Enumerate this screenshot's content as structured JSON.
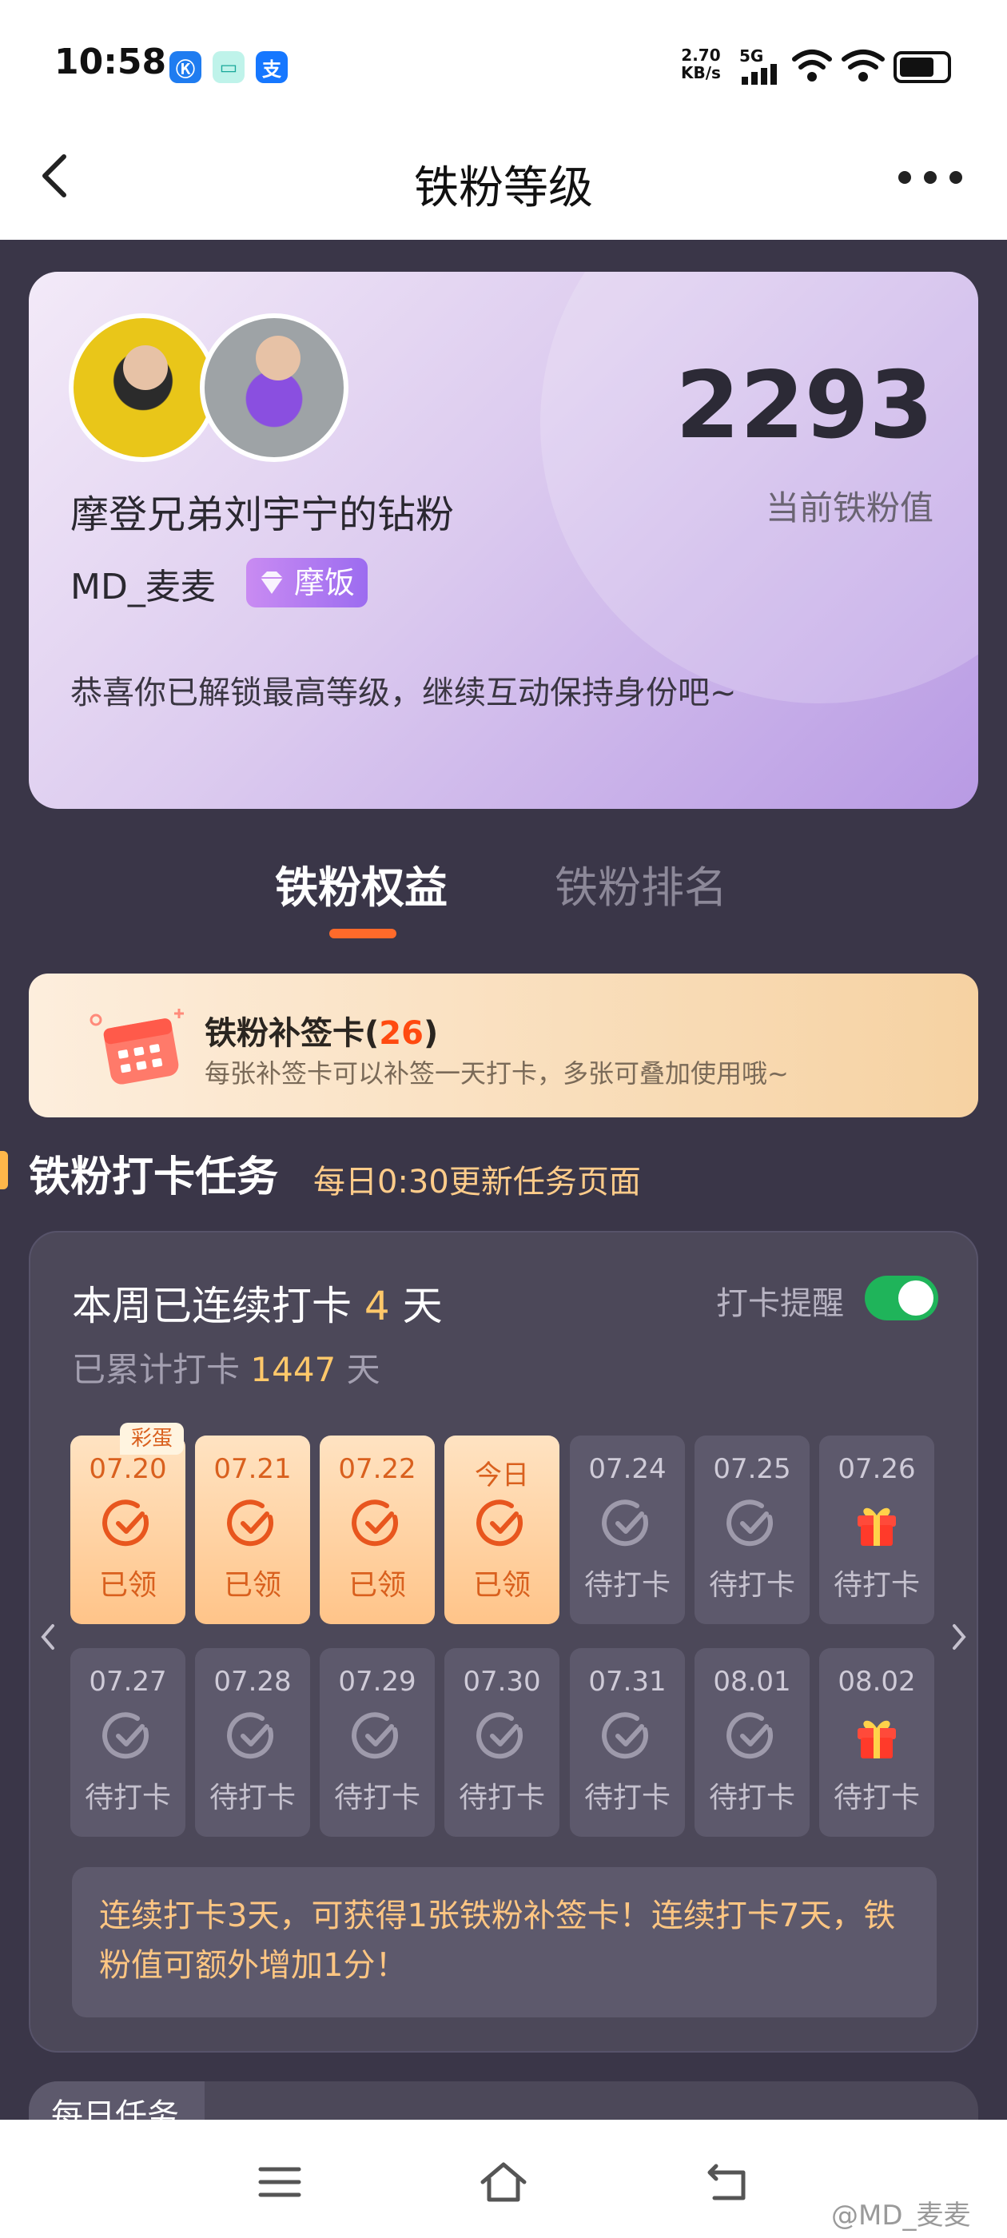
{
  "status_bar": {
    "time": "10:58",
    "network_speed": "2.70",
    "network_unit": "KB/s",
    "cellular": "5G",
    "battery_level": 0.75
  },
  "header": {
    "title": "铁粉等级"
  },
  "profile": {
    "fan_value": "2293",
    "fan_value_label": "当前铁粉值",
    "fan_title": "摩登兄弟刘宇宁的钻粉",
    "username": "MD_麦麦",
    "badge": "摩饭",
    "congrats": "恭喜你已解锁最高等级，继续互动保持身份吧~"
  },
  "tabs": [
    {
      "label": "铁粉权益",
      "active": true
    },
    {
      "label": "铁粉排名",
      "active": false
    }
  ],
  "resign_card": {
    "title": "铁粉补签卡",
    "count_open": "(",
    "count": "26",
    "count_close": ")",
    "desc": "每张补签卡可以补签一天打卡，多张可叠加使用哦~"
  },
  "section": {
    "title": "铁粉打卡任务",
    "subtitle": "每日0:30更新任务页面"
  },
  "checkin": {
    "streak_prefix": "本周已连续打卡",
    "streak_days": "4",
    "streak_suffix": "天",
    "total_prefix": "已累计打卡",
    "total_days": "1447",
    "total_suffix": "天",
    "reminder_label": "打卡提醒",
    "reminder_on": true,
    "egg_tag": "彩蛋",
    "days": [
      {
        "date": "07.20",
        "status": "已领",
        "done": true,
        "gift": false
      },
      {
        "date": "07.21",
        "status": "已领",
        "done": true,
        "gift": false
      },
      {
        "date": "07.22",
        "status": "已领",
        "done": true,
        "gift": false
      },
      {
        "date": "今日",
        "status": "已领",
        "done": true,
        "gift": false
      },
      {
        "date": "07.24",
        "status": "待打卡",
        "done": false,
        "gift": false
      },
      {
        "date": "07.25",
        "status": "待打卡",
        "done": false,
        "gift": false
      },
      {
        "date": "07.26",
        "status": "待打卡",
        "done": false,
        "gift": true
      },
      {
        "date": "07.27",
        "status": "待打卡",
        "done": false,
        "gift": false
      },
      {
        "date": "07.28",
        "status": "待打卡",
        "done": false,
        "gift": false
      },
      {
        "date": "07.29",
        "status": "待打卡",
        "done": false,
        "gift": false
      },
      {
        "date": "07.30",
        "status": "待打卡",
        "done": false,
        "gift": false
      },
      {
        "date": "07.31",
        "status": "待打卡",
        "done": false,
        "gift": false
      },
      {
        "date": "08.01",
        "status": "待打卡",
        "done": false,
        "gift": false
      },
      {
        "date": "08.02",
        "status": "待打卡",
        "done": false,
        "gift": true
      }
    ],
    "tip": "连续打卡3天，可获得1张铁粉补签卡！连续打卡7天，铁粉值可额外增加1分！"
  },
  "daily_tasks": {
    "label": "每日任务"
  },
  "watermark": "@MD_麦麦",
  "colors": {
    "accent": "#ff6a2a",
    "highlight": "#ffc86a",
    "toggle_on": "#1fb45a",
    "background": "#3a3648"
  }
}
